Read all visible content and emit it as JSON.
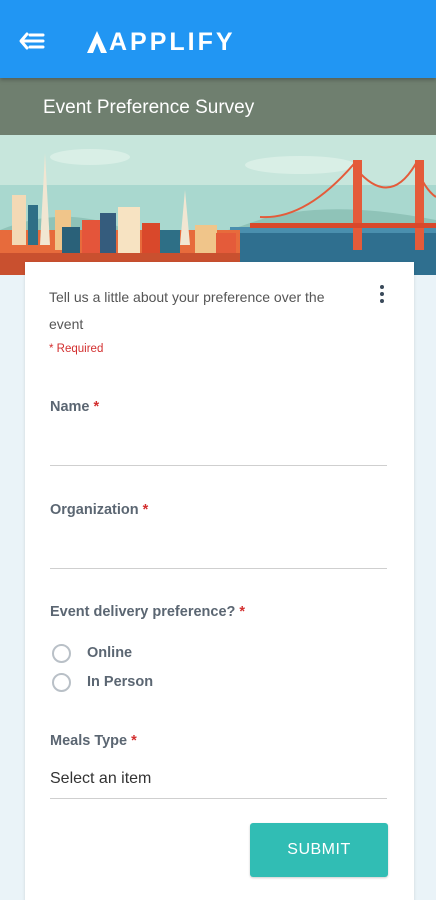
{
  "appbar": {
    "brand": "APPLIFY",
    "back_icon": "back-menu-icon"
  },
  "titlebar": {
    "title": "Event Preference Survey"
  },
  "form": {
    "intro": "Tell us a little about your preference over the event",
    "required_note": "* Required",
    "fields": {
      "name": {
        "label": "Name",
        "value": "",
        "required": true
      },
      "organization": {
        "label": "Organization",
        "value": "",
        "required": true
      },
      "delivery": {
        "label": "Event delivery preference?",
        "options": [
          "Online",
          "In Person"
        ],
        "required": true
      },
      "meals": {
        "label": "Meals Type",
        "selected": "Select an item",
        "required": true
      }
    },
    "star": "*",
    "submit_label": "SUBMIT"
  },
  "colors": {
    "appbar": "#2196f3",
    "titlebar": "#6f7f6f",
    "accent": "#31bdb4",
    "required": "#d32f2f",
    "label": "#5b6672"
  }
}
